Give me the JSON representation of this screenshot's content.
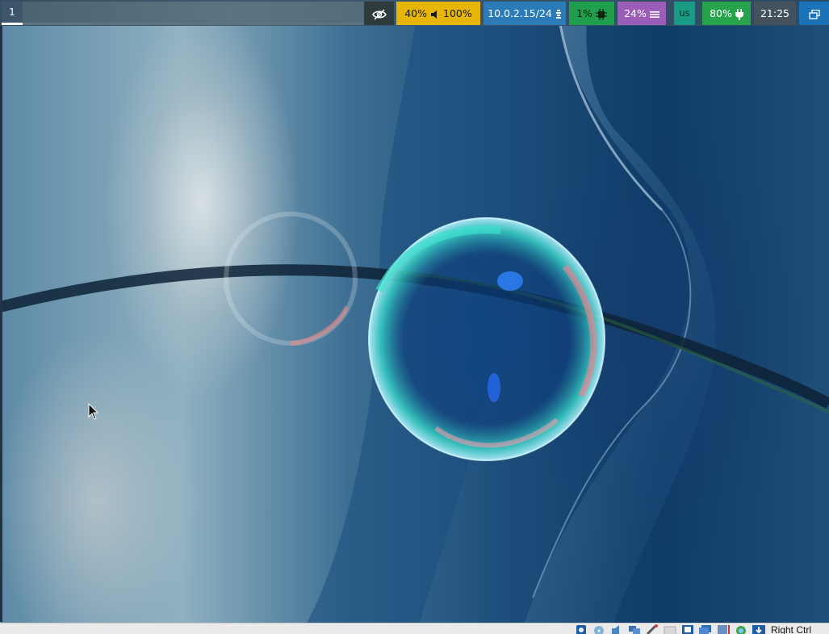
{
  "workspace": {
    "current": "1"
  },
  "statusbar": {
    "volume": {
      "brightness": "40%",
      "level": "100%"
    },
    "network": {
      "ip": "10.0.2.15/24"
    },
    "cpu": {
      "usage": "1%"
    },
    "memory": {
      "usage": "24%"
    },
    "keyboard": {
      "layout": "us"
    },
    "battery": {
      "level": "80%"
    },
    "clock": {
      "time": "21:25"
    }
  },
  "vm_statusbar": {
    "host_key": "Right Ctrl",
    "icons": [
      "hard-disk-icon",
      "optical-drive-icon",
      "audio-icon",
      "network-icon",
      "usb-icon",
      "shared-folders-icon",
      "display-icon",
      "video-capture-icon",
      "cpu-icon",
      "mouse-integration-icon",
      "keyboard-capture-icon"
    ]
  },
  "colors": {
    "volume_bg": "#e6b508",
    "network_bg": "#2b7bb8",
    "cpu_bg": "#1f9e4e",
    "memory_bg": "#9b5db7",
    "keyboard_bg": "#1a9b86",
    "battery_bg": "#26a44c",
    "clock_bg": "#43525d",
    "window_bg": "#1a73b8"
  }
}
